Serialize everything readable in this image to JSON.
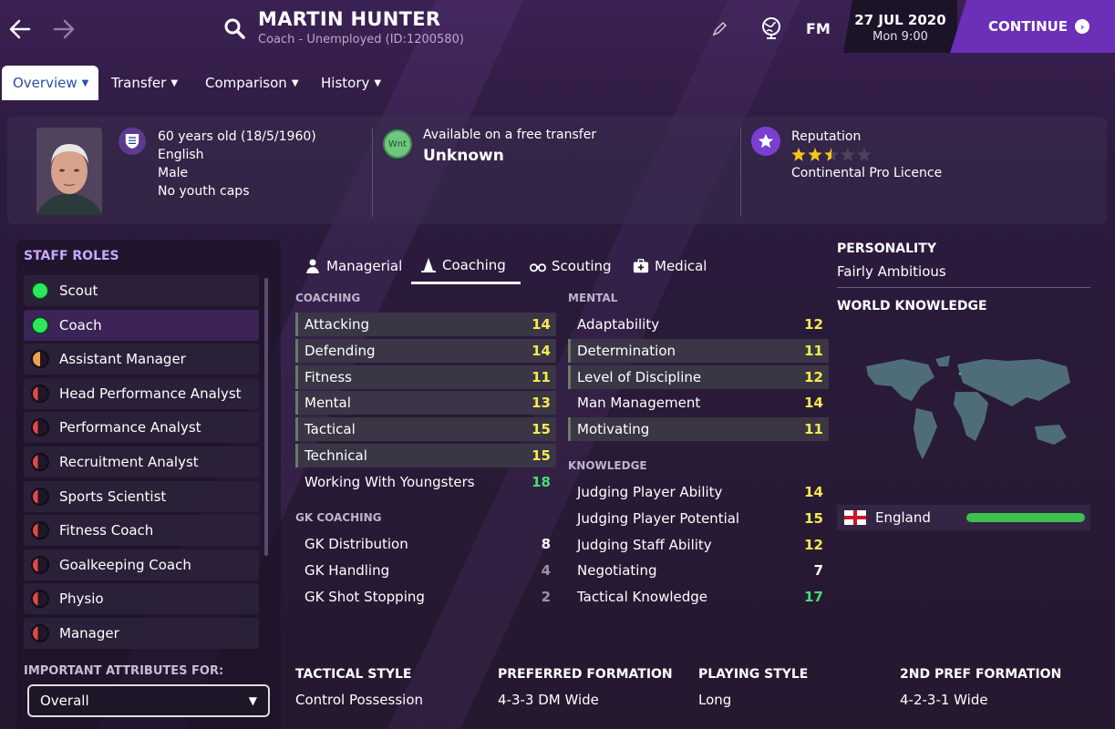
{
  "header": {
    "name": "MARTIN HUNTER",
    "subtitle": "Coach - Unemployed (ID:1200580)",
    "logo_text": "FM",
    "date": "27 JUL 2020",
    "time": "Mon 9:00",
    "continue_label": "CONTINUE"
  },
  "tabs": [
    {
      "label": "Overview"
    },
    {
      "label": "Transfer"
    },
    {
      "label": "Comparison"
    },
    {
      "label": "History"
    }
  ],
  "profile": {
    "age": "60 years old (18/5/1960)",
    "nationality": "English",
    "gender": "Male",
    "caps": "No youth caps",
    "transfer_badge": "Wnt",
    "transfer_status": "Available on a free transfer",
    "transfer_value": "Unknown",
    "reputation_label": "Reputation",
    "reputation_stars": 2.5,
    "licence": "Continental Pro Licence"
  },
  "sidebar": {
    "title": "STAFF ROLES",
    "roles": [
      {
        "label": "Scout",
        "level": "green"
      },
      {
        "label": "Coach",
        "level": "green"
      },
      {
        "label": "Assistant Manager",
        "level": "half"
      },
      {
        "label": "Head Performance Analyst",
        "level": "low"
      },
      {
        "label": "Performance Analyst",
        "level": "low"
      },
      {
        "label": "Recruitment Analyst",
        "level": "low"
      },
      {
        "label": "Sports Scientist",
        "level": "low"
      },
      {
        "label": "Fitness Coach",
        "level": "low"
      },
      {
        "label": "Goalkeeping Coach",
        "level": "low"
      },
      {
        "label": "Physio",
        "level": "low"
      },
      {
        "label": "Manager",
        "level": "low"
      }
    ],
    "important_label": "IMPORTANT ATTRIBUTES FOR:",
    "dropdown_value": "Overall"
  },
  "subtabs": [
    {
      "label": "Managerial"
    },
    {
      "label": "Coaching"
    },
    {
      "label": "Scouting"
    },
    {
      "label": "Medical"
    }
  ],
  "coaching": {
    "title": "COACHING",
    "items": [
      {
        "label": "Attacking",
        "value": "14"
      },
      {
        "label": "Defending",
        "value": "14"
      },
      {
        "label": "Fitness",
        "value": "11"
      },
      {
        "label": "Mental",
        "value": "13"
      },
      {
        "label": "Tactical",
        "value": "15"
      },
      {
        "label": "Technical",
        "value": "15"
      },
      {
        "label": "Working With Youngsters",
        "value": "18"
      }
    ]
  },
  "gk_coaching": {
    "title": "GK COACHING",
    "items": [
      {
        "label": "GK Distribution",
        "value": "8"
      },
      {
        "label": "GK Handling",
        "value": "4"
      },
      {
        "label": "GK Shot Stopping",
        "value": "2"
      }
    ]
  },
  "mental": {
    "title": "MENTAL",
    "items": [
      {
        "label": "Adaptability",
        "value": "12"
      },
      {
        "label": "Determination",
        "value": "11"
      },
      {
        "label": "Level of Discipline",
        "value": "12"
      },
      {
        "label": "Man Management",
        "value": "14"
      },
      {
        "label": "Motivating",
        "value": "11"
      }
    ]
  },
  "knowledge": {
    "title": "KNOWLEDGE",
    "items": [
      {
        "label": "Judging Player Ability",
        "value": "14"
      },
      {
        "label": "Judging Player Potential",
        "value": "15"
      },
      {
        "label": "Judging Staff Ability",
        "value": "12"
      },
      {
        "label": "Negotiating",
        "value": "7"
      },
      {
        "label": "Tactical Knowledge",
        "value": "17"
      }
    ]
  },
  "personality": {
    "title": "PERSONALITY",
    "value": "Fairly Ambitious"
  },
  "world_knowledge": {
    "title": "WORLD KNOWLEDGE",
    "country": "England",
    "knowledge_fraction": 1.0
  },
  "preferences": {
    "tactical_style_label": "TACTICAL STYLE",
    "tactical_style": "Control Possession",
    "formation_label": "PREFERRED FORMATION",
    "formation": "4-3-3 DM Wide",
    "playing_style_label": "PLAYING STYLE",
    "playing_style": "Long",
    "second_formation_label": "2ND PREF FORMATION",
    "second_formation": "4-2-3-1 Wide"
  },
  "colors": {
    "accent": "#6b2fb8",
    "high_value": "#42e071",
    "mid_value": "#f7ea4f",
    "sidebar_title": "#c9a7ff"
  }
}
